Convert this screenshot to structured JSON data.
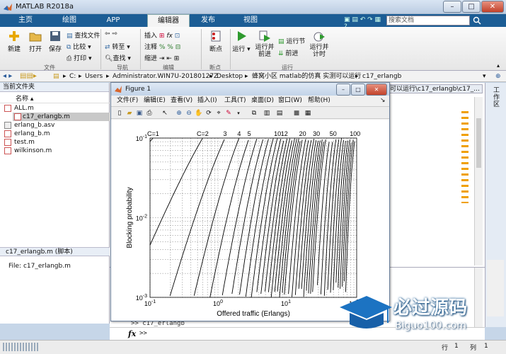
{
  "window": {
    "title": "MATLAB R2018a",
    "minimize": "–",
    "maximize": "□",
    "close": "✕"
  },
  "tabs": [
    "主页",
    "绘图",
    "APP",
    "编辑器",
    "发布",
    "视图"
  ],
  "search": {
    "placeholder": "搜索文档"
  },
  "ribbon": {
    "new": "新建",
    "open": "打开",
    "save": "保存",
    "find_files": "查找文件",
    "compare": "比较",
    "print": "打印",
    "group_file": "文件",
    "insert": "插入",
    "comment": "注释",
    "indent": "缩进",
    "goto": "转至",
    "find": "查找",
    "group_nav": "导航",
    "group_edit": "编辑",
    "breakpoints": "断点",
    "group_bp": "断点",
    "run": "运行",
    "run_advance": "运行并前进",
    "run_section": "运行节",
    "advance": "前进",
    "run_time": "运行并计时",
    "group_run": "运行"
  },
  "address": {
    "drive": "C:",
    "parts": [
      "Users",
      "Administrator.WIN7U-20180127Z",
      "Desktop",
      "蜂窝小区 matlab的仿真 实测可以运行",
      "c17_erlangb"
    ]
  },
  "current_folder": {
    "title": "当前文件夹",
    "col_name": "名称",
    "files": [
      "ALL.m",
      "c17_erlangb.m",
      "erlang_b.asv",
      "erlang_b.m",
      "test.m",
      "wilkinson.m"
    ],
    "selected": "c17_erlangb.m"
  },
  "details": {
    "title": "c17_erlangb.m (脚本)",
    "file_label": "File: c17_erlangb.m"
  },
  "editor_tab": "可以运行\\c17_erlangb\\c17_...",
  "cmd": {
    "prev": ">> c17_erlangb",
    "prompt": ">>",
    "fx": "fx"
  },
  "workspace_label": "工作区",
  "status": {
    "row_label": "行",
    "row": "1",
    "col_label": "列",
    "col": "1"
  },
  "figure": {
    "title": "Figure 1",
    "menu": [
      "文件(F)",
      "编辑(E)",
      "查看(V)",
      "插入(I)",
      "工具(T)",
      "桌面(D)",
      "窗口(W)",
      "帮助(H)"
    ]
  },
  "watermark": {
    "brand": "必过源码",
    "url": "Biguo100.com"
  },
  "chart_data": {
    "type": "line",
    "xlabel": "Offered traffic (Erlangs)",
    "ylabel": "Blocking probability",
    "x_scale": "log",
    "y_scale": "log",
    "xlim": [
      0.1,
      110
    ],
    "ylim": [
      0.001,
      0.1
    ],
    "x_ticks": [
      {
        "v": 0.1,
        "label": "10^-1"
      },
      {
        "v": 1,
        "label": "10^0"
      },
      {
        "v": 10,
        "label": "10^1"
      },
      {
        "v": 100,
        "label": "10^2"
      }
    ],
    "y_ticks": [
      {
        "v": 0.1,
        "label": "10^-1"
      },
      {
        "v": 0.01,
        "label": "10^-2"
      },
      {
        "v": 0.001,
        "label": "10^-3"
      }
    ],
    "grid": true,
    "C_values": [
      1,
      2,
      3,
      4,
      5,
      6,
      7,
      8,
      9,
      10,
      11,
      12,
      13,
      14,
      15,
      16,
      17,
      18,
      19,
      20,
      22,
      24,
      26,
      28,
      30,
      32,
      34,
      36,
      38,
      40,
      45,
      50,
      55,
      60,
      65,
      70,
      75,
      80,
      85,
      90,
      95,
      100
    ],
    "curve_labels": [
      {
        "C": 1,
        "text": "C=1"
      },
      {
        "C": 2,
        "text": "C=2"
      },
      {
        "C": 3,
        "text": "3"
      },
      {
        "C": 4,
        "text": "4"
      },
      {
        "C": 5,
        "text": "5"
      },
      {
        "C": 10,
        "text": "10"
      },
      {
        "C": 12,
        "text": "12"
      },
      {
        "C": 20,
        "text": "20"
      },
      {
        "C": 30,
        "text": "30"
      },
      {
        "C": 50,
        "text": "50"
      },
      {
        "C": 100,
        "text": "100"
      }
    ]
  }
}
